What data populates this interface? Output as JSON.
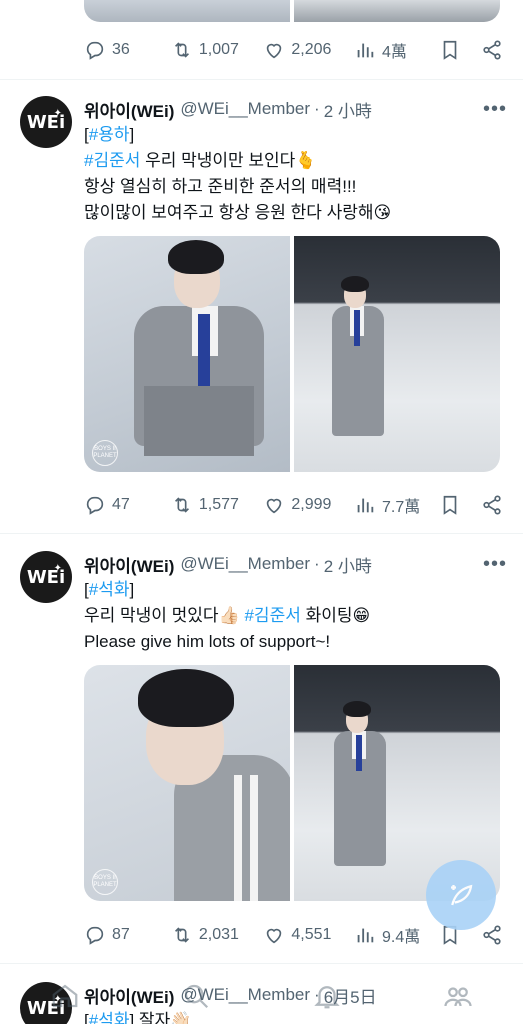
{
  "top_stats": {
    "replies": "36",
    "retweets": "1,007",
    "likes": "2,206",
    "views": "4萬"
  },
  "tweets": [
    {
      "avatar_text": "WEi",
      "name": "위아이(WEi)",
      "handle": "@WEi__Member",
      "sep": "·",
      "time": "2 小時",
      "lines": [
        {
          "pre": "[",
          "tag": "#용하",
          "post": "]"
        },
        {
          "pre": "",
          "tag": "#김준서",
          "post": " 우리 막냉이만 보인다🫰"
        },
        {
          "pre": "항상 열심히 하고 준비한 준서의 매력!!!",
          "tag": "",
          "post": ""
        },
        {
          "pre": "많이많이 보여주고 항상 응원 한다 사랑해😘",
          "tag": "",
          "post": ""
        }
      ],
      "watermark": "BOYS II PLANET",
      "stats": {
        "replies": "47",
        "retweets": "1,577",
        "likes": "2,999",
        "views": "7.7萬"
      }
    },
    {
      "avatar_text": "WEi",
      "name": "위아이(WEi)",
      "handle": "@WEi__Member",
      "sep": "·",
      "time": "2 小時",
      "lines": [
        {
          "pre": "[",
          "tag": "#석화",
          "post": "]"
        },
        {
          "pre": "우리 막냉이 멋있다👍🏻 ",
          "tag": "#김준서",
          "post": " 화이팅😁"
        },
        {
          "pre": "Please give him lots of support~!",
          "tag": "",
          "post": ""
        }
      ],
      "watermark": "BOYS II PLANET",
      "stats": {
        "replies": "87",
        "retweets": "2,031",
        "likes": "4,551",
        "views": "9.4萬"
      }
    },
    {
      "avatar_text": "WEi",
      "name": "위아이(WEi)",
      "handle": "@WEi__Member",
      "sep": "·",
      "time": "6月5日",
      "lines": [
        {
          "pre": "[",
          "tag": "#석화",
          "post": "] 잘자👋🏻"
        }
      ]
    }
  ],
  "icons": [
    "reply-icon",
    "retweet-icon",
    "like-icon",
    "views-icon",
    "bookmark-icon",
    "share-icon",
    "more-icon",
    "compose-icon",
    "home-icon",
    "search-icon",
    "notifications-icon",
    "communities-icon"
  ],
  "colors": {
    "link": "#1d9bf0",
    "muted": "#536471",
    "fab": "#a9d2f7"
  }
}
